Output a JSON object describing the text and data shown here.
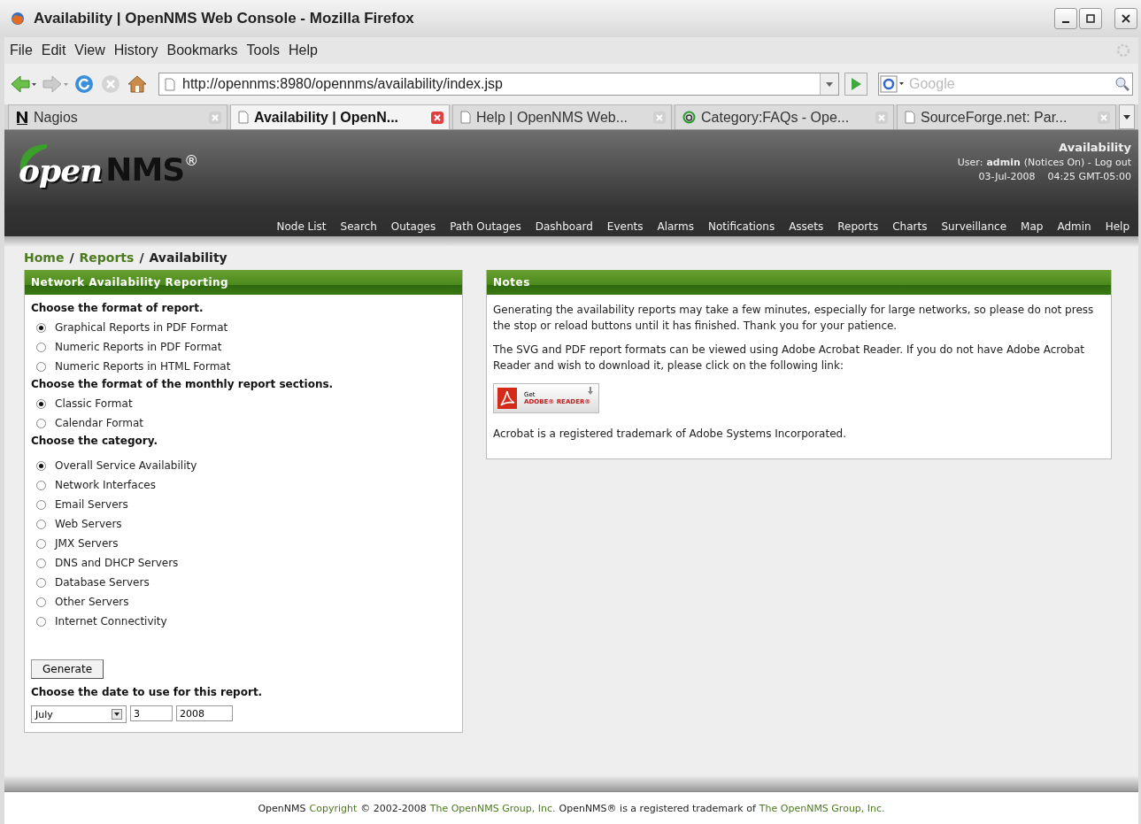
{
  "window": {
    "title": "Availability | OpenNMS Web Console - Mozilla Firefox"
  },
  "menu": [
    "File",
    "Edit",
    "View",
    "History",
    "Bookmarks",
    "Tools",
    "Help"
  ],
  "toolbar": {
    "url": "http://opennms:8980/opennms/availability/index.jsp",
    "search": {
      "placeholder": "Google"
    }
  },
  "tabs": [
    {
      "label": "Nagios",
      "selected": false,
      "kind": "nagios"
    },
    {
      "label": "Availability | OpenN...",
      "selected": true,
      "kind": "page"
    },
    {
      "label": "Help | OpenNMS Web...",
      "selected": false,
      "kind": "page"
    },
    {
      "label": "Category:FAQs - Ope...",
      "selected": false,
      "kind": "wiki"
    },
    {
      "label": "SourceForge.net: Par...",
      "selected": false,
      "kind": "page"
    }
  ],
  "header": {
    "logo": {
      "part1": "open",
      "part2": "NMS",
      "mark": "®"
    },
    "page_title": "Availability",
    "user_label": "User:",
    "user_name": "admin",
    "notices": "(Notices On) -",
    "logout": "Log out",
    "date": "03-Jul-2008",
    "time": "04:25 GMT-05:00"
  },
  "nav": [
    "Node List",
    "Search",
    "Outages",
    "Path Outages",
    "Dashboard",
    "Events",
    "Alarms",
    "Notifications",
    "Assets",
    "Reports",
    "Charts",
    "Surveillance",
    "Map",
    "Admin",
    "Help"
  ],
  "breadcrumb": {
    "separator": "/",
    "links": [
      "Home",
      "Reports"
    ],
    "current": "Availability"
  },
  "report_panel": {
    "title": "Network Availability Reporting",
    "sections": [
      {
        "heading": "Choose the format of report.",
        "options": [
          {
            "label": "Graphical Reports in PDF Format",
            "selected": true
          },
          {
            "label": "Numeric Reports in PDF Format",
            "selected": false
          },
          {
            "label": "Numeric Reports in HTML Format",
            "selected": false
          }
        ]
      },
      {
        "heading": "Choose the format of the monthly report sections.",
        "options": [
          {
            "label": "Classic Format",
            "selected": true
          },
          {
            "label": "Calendar Format",
            "selected": false
          }
        ]
      },
      {
        "heading": "Choose the category.",
        "options": [
          {
            "label": "Overall Service Availability",
            "selected": true
          },
          {
            "label": "Network Interfaces",
            "selected": false
          },
          {
            "label": "Email Servers",
            "selected": false
          },
          {
            "label": "Web Servers",
            "selected": false
          },
          {
            "label": "JMX Servers",
            "selected": false
          },
          {
            "label": "DNS and DHCP Servers",
            "selected": false
          },
          {
            "label": "Database Servers",
            "selected": false
          },
          {
            "label": "Other Servers",
            "selected": false
          },
          {
            "label": "Internet Connectivity",
            "selected": false
          }
        ]
      }
    ],
    "generate": "Generate",
    "date_heading": "Choose the date to use for this report.",
    "month": "July",
    "day": "3",
    "year": "2008"
  },
  "notes_panel": {
    "title": "Notes",
    "paragraphs": [
      "Generating the availability reports may take a few minutes, especially for large networks, so please do not press the stop or reload buttons until it has finished. Thank you for your patience.",
      "The SVG and PDF report formats can be viewed using Adobe Acrobat Reader. If you do not have Adobe Acrobat Reader and wish to download it, please click on the following link:"
    ],
    "badge": {
      "line1": "Get",
      "line2": "ADOBE® READER®"
    },
    "trademark": "Acrobat is a registered trademark of Adobe Systems Incorporated."
  },
  "footer": [
    {
      "kind": "text",
      "text": "OpenNMS"
    },
    {
      "kind": "link",
      "text": "Copyright"
    },
    {
      "kind": "text",
      "text": "© 2002-2008"
    },
    {
      "kind": "link",
      "text": "The OpenNMS Group, Inc."
    },
    {
      "kind": "text",
      "text": "OpenNMS® is a registered trademark of"
    },
    {
      "kind": "link",
      "text": "The OpenNMS Group, Inc."
    }
  ]
}
